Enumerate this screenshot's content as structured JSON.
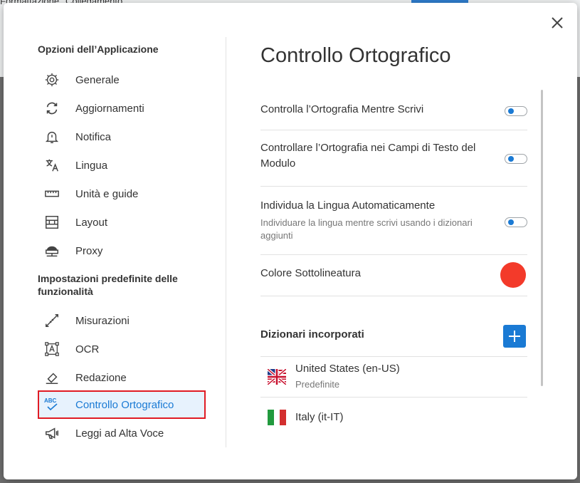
{
  "background": {
    "tabs": [
      "Formattazione",
      "Collegamento"
    ]
  },
  "sidebar": {
    "heading_app": "Opzioni dell’Applicazione",
    "heading_features": "Impostazioni predefinite delle funzionalità",
    "app_items": [
      {
        "label": "Generale",
        "icon": "gear-icon"
      },
      {
        "label": "Aggiornamenti",
        "icon": "refresh-icon"
      },
      {
        "label": "Notifica",
        "icon": "bell-icon"
      },
      {
        "label": "Lingua",
        "icon": "translate-icon"
      },
      {
        "label": "Unità e guide",
        "icon": "ruler-icon"
      },
      {
        "label": "Layout",
        "icon": "layout-icon"
      },
      {
        "label": "Proxy",
        "icon": "proxy-icon"
      }
    ],
    "feature_items": [
      {
        "label": "Misurazioni",
        "icon": "measure-icon"
      },
      {
        "label": "OCR",
        "icon": "ocr-icon"
      },
      {
        "label": "Redazione",
        "icon": "eraser-icon"
      },
      {
        "label": "Controllo Ortografico",
        "icon": "spellcheck-icon",
        "active": true
      },
      {
        "label": "Leggi ad Alta Voce",
        "icon": "megaphone-icon"
      }
    ]
  },
  "main": {
    "title": "Controllo Ortografico",
    "settings": [
      {
        "label": "Controlla l’Ortografia Mentre Scrivi",
        "enabled": true
      },
      {
        "label": "Controllare l’Ortografia nei Campi di Testo del Modulo",
        "enabled": true
      },
      {
        "label": "Individua la Lingua Automaticamente",
        "description": "Individuare la lingua mentre scrivi usando i dizionari aggiunti",
        "enabled": true
      }
    ],
    "underline_color": {
      "label": "Colore Sottolineatura",
      "color": "#f33a2a"
    },
    "dictionaries": {
      "heading": "Dizionari incorporati",
      "items": [
        {
          "name": "United States (en-US)",
          "sub": "Predefinite",
          "flag": "us-uk-flag"
        },
        {
          "name": "Italy (it-IT)",
          "flag": "italy-flag"
        }
      ]
    }
  },
  "colors": {
    "accent": "#1a7ad4",
    "active_bg": "#e7f2fd",
    "highlight_border": "#e01b24"
  }
}
